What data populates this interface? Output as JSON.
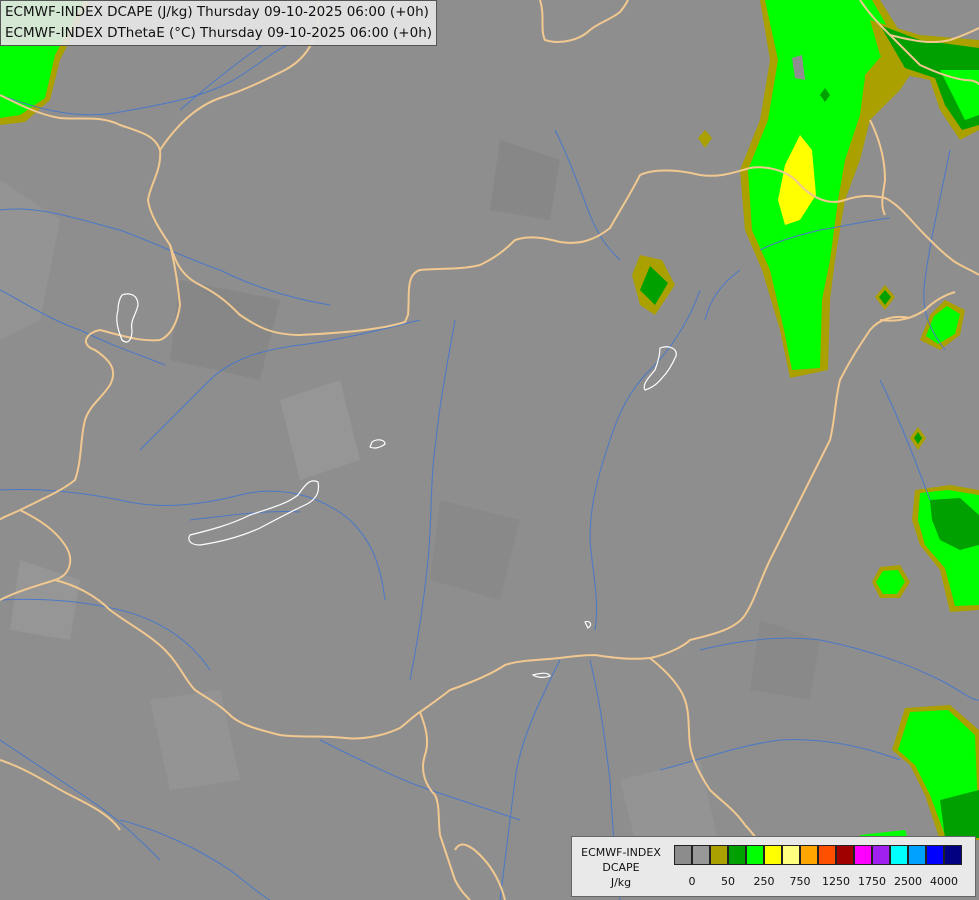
{
  "titles": [
    "ECMWF-INDEX DCAPE (J/kg) Thursday 09-10-2025 06:00 (+0h)",
    "ECMWF-INDEX DThetaE (°C) Thursday 09-10-2025 06:00 (+0h)"
  ],
  "legend": {
    "title": [
      "ECMWF-INDEX",
      "DCAPE",
      "J/kg"
    ],
    "colors": [
      "#8c8c8c",
      "#989898",
      "#aaa000",
      "#00a000",
      "#00ff00",
      "#ffff00",
      "#ffff80",
      "#ffa500",
      "#ff5000",
      "#a00000",
      "#ff00ff",
      "#a020f0",
      "#00ffff",
      "#00a0ff",
      "#0000ff",
      "#000080"
    ],
    "ticks": [
      {
        "label": "0",
        "index": 1
      },
      {
        "label": "50",
        "index": 3
      },
      {
        "label": "250",
        "index": 5
      },
      {
        "label": "750",
        "index": 7
      },
      {
        "label": "1250",
        "index": 9
      },
      {
        "label": "1750",
        "index": 11
      },
      {
        "label": "2500",
        "index": 13
      },
      {
        "label": "4000",
        "index": 15
      }
    ]
  },
  "colors": {
    "background": "#8e8e8e",
    "border": "#f0c890",
    "river": "#4a78c8",
    "lake": "#ffffff"
  }
}
